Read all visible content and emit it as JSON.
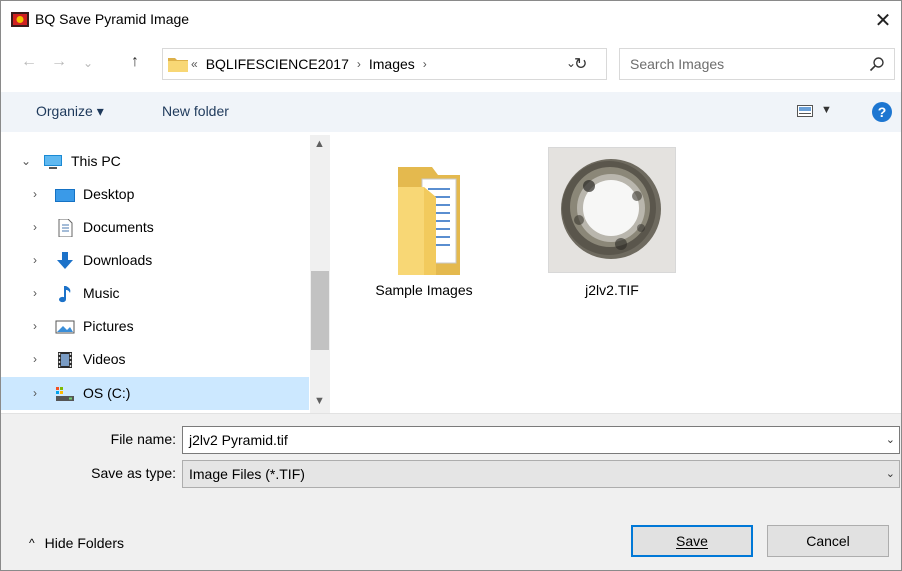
{
  "window": {
    "title": "BQ Save Pyramid Image",
    "close_glyph": "✕"
  },
  "nav": {
    "back_glyph": "←",
    "forward_glyph": "→",
    "history_glyph": "⌄",
    "up_glyph": "↑",
    "breadcrumbs": [
      "«",
      "BQLIFESCIENCE2017",
      "›",
      "Images",
      "›"
    ],
    "address_dropdown_glyph": "⌄",
    "refresh_glyph": "↻",
    "search_placeholder": "Search Images"
  },
  "toolbar": {
    "organize_label": "Organize ▾",
    "new_folder_label": "New folder",
    "view_dropdown_glyph": "▼",
    "help_label": "?"
  },
  "tree": [
    {
      "label": "This PC",
      "icon": "computer-icon",
      "chevron": "⌄"
    },
    {
      "label": "Desktop",
      "icon": "desktop-icon",
      "chevron": "›"
    },
    {
      "label": "Documents",
      "icon": "documents-icon",
      "chevron": "›"
    },
    {
      "label": "Downloads",
      "icon": "downloads-icon",
      "chevron": "›"
    },
    {
      "label": "Music",
      "icon": "music-icon",
      "chevron": "›"
    },
    {
      "label": "Pictures",
      "icon": "pictures-icon",
      "chevron": "›"
    },
    {
      "label": "Videos",
      "icon": "videos-icon",
      "chevron": "›"
    },
    {
      "label": "OS (C:)",
      "icon": "drive-icon",
      "chevron": "›",
      "selected": true
    }
  ],
  "files": [
    {
      "label": "Sample Images",
      "icon": "folder-icon"
    },
    {
      "label": "j2lv2.TIF",
      "icon": "image-thumbnail"
    }
  ],
  "form": {
    "file_name_label": "File name:",
    "file_name_value": "j2lv2 Pyramid.tif",
    "save_type_label": "Save as type:",
    "save_type_value": "Image Files (*.TIF)"
  },
  "footer": {
    "hide_folders_glyph": "^",
    "hide_folders_label": "Hide Folders",
    "save_label": "Save",
    "cancel_label": "Cancel"
  },
  "colors": {
    "toolbar_bg": "#f0f4f9",
    "selection": "#cce8ff",
    "accent": "#0078d7",
    "folder": "#f8d775"
  }
}
